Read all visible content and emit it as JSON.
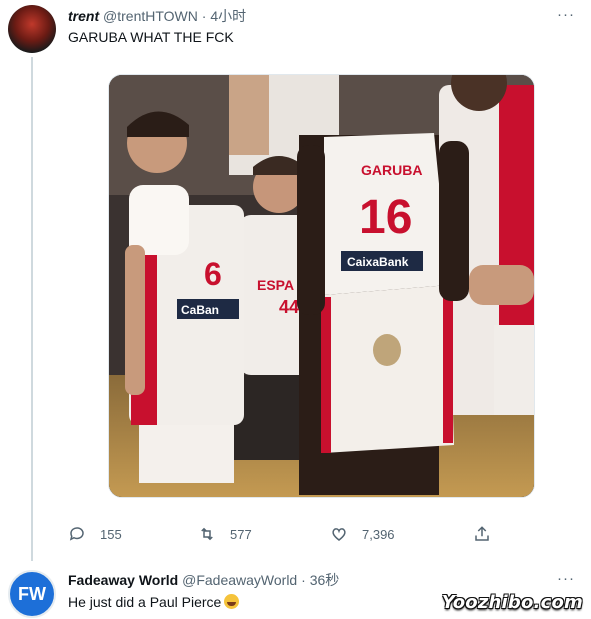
{
  "tweets": [
    {
      "name": "trent",
      "handle": "@trentHTOWN",
      "separator": "·",
      "time": "4小时",
      "text": "GARUBA WHAT THE FCK",
      "more": "···",
      "actions": {
        "reply": "155",
        "retweet": "577",
        "like": "7,396"
      },
      "media": {
        "back_name": "GARUBA",
        "back_number": "16",
        "sponsor": "CaixaBank",
        "left_number": "6",
        "left_sponsor": "CaBan",
        "front_text": "ESPA",
        "front_number": "44"
      }
    },
    {
      "avatar_initials": "FW",
      "name": "Fadeaway World",
      "handle": "@FadeawayWorld",
      "separator": "·",
      "time": "36秒",
      "text": "He just did a Paul Pierce",
      "emoji": "rolling-on-floor-laughing",
      "more": "···"
    }
  ],
  "watermark": "Yoozhibo.com",
  "colors": {
    "text": "#0f1419",
    "secondary": "#536471",
    "line": "#cfd9de",
    "fw_blue": "#1d6fd8",
    "spain_red": "#c8102e"
  }
}
